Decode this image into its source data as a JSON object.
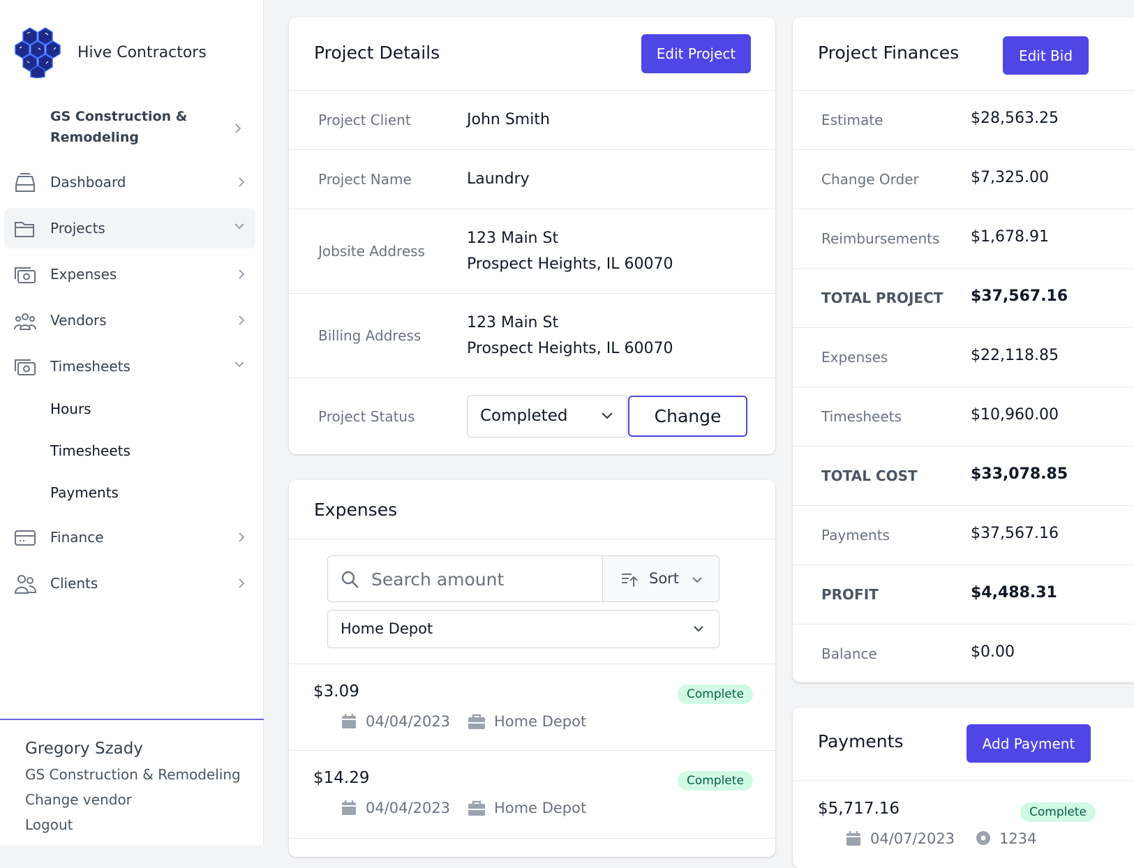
{
  "brand": {
    "name": "Hive Contractors"
  },
  "sidebar": {
    "org": "GS Construction & Remodeling",
    "items": [
      {
        "label": "Dashboard",
        "icon": "inbox-icon"
      },
      {
        "label": "Projects",
        "icon": "folder-icon"
      },
      {
        "label": "Expenses",
        "icon": "cash-icon"
      },
      {
        "label": "Vendors",
        "icon": "user-group-icon"
      },
      {
        "label": "Timesheets",
        "icon": "cash-icon"
      },
      {
        "label": "Finance",
        "icon": "credit-card-icon"
      },
      {
        "label": "Clients",
        "icon": "users-icon"
      }
    ],
    "subitems": [
      "Hours",
      "Timesheets",
      "Payments"
    ]
  },
  "footer": {
    "user_name": "Gregory Szady",
    "org": "GS Construction & Remodeling",
    "change_vendor": "Change vendor",
    "logout": "Logout"
  },
  "project_details": {
    "title": "Project Details",
    "edit_button": "Edit Project",
    "client_label": "Project Client",
    "client_value": "John Smith",
    "name_label": "Project Name",
    "name_value": "Laundry",
    "jobsite_label": "Jobsite Address",
    "jobsite_line1": "123 Main St",
    "jobsite_line2": "Prospect Heights, IL 60070",
    "billing_label": "Billing Address",
    "billing_line1": "123 Main St",
    "billing_line2": "Prospect Heights, IL 60070",
    "status_label": "Project Status",
    "status_value": "Completed",
    "change_button": "Change"
  },
  "expenses": {
    "title": "Expenses",
    "search_placeholder": "Search amount",
    "sort_label": "Sort",
    "vendor_filter": "Home Depot",
    "items": [
      {
        "amount": "$3.09",
        "status": "Complete",
        "date": "04/04/2023",
        "vendor": "Home Depot"
      },
      {
        "amount": "$14.29",
        "status": "Complete",
        "date": "04/04/2023",
        "vendor": "Home Depot"
      }
    ]
  },
  "finances": {
    "title": "Project Finances",
    "edit_button": "Edit Bid",
    "rows": [
      {
        "label": "Estimate",
        "value": "$28,563.25"
      },
      {
        "label": "Change Order",
        "value": "$7,325.00"
      },
      {
        "label": "Reimbursements",
        "value": "$1,678.91"
      },
      {
        "label": "TOTAL PROJECT",
        "value": "$37,567.16"
      },
      {
        "label": "Expenses",
        "value": "$22,118.85"
      },
      {
        "label": "Timesheets",
        "value": "$10,960.00"
      },
      {
        "label": "TOTAL COST",
        "value": "$33,078.85"
      },
      {
        "label": "Payments",
        "value": "$37,567.16"
      },
      {
        "label": "PROFIT",
        "value": "$4,488.31"
      },
      {
        "label": "Balance",
        "value": "$0.00"
      }
    ]
  },
  "payments": {
    "title": "Payments",
    "add_button": "Add Payment",
    "items": [
      {
        "amount": "$5,717.16",
        "status": "Complete",
        "date": "04/07/2023",
        "ref": "1234"
      }
    ]
  },
  "colors": {
    "accent": "#4f46e5",
    "badge_bg": "#d1fae5",
    "badge_text": "#065f46",
    "brand_hex": "#1e2a8a"
  }
}
